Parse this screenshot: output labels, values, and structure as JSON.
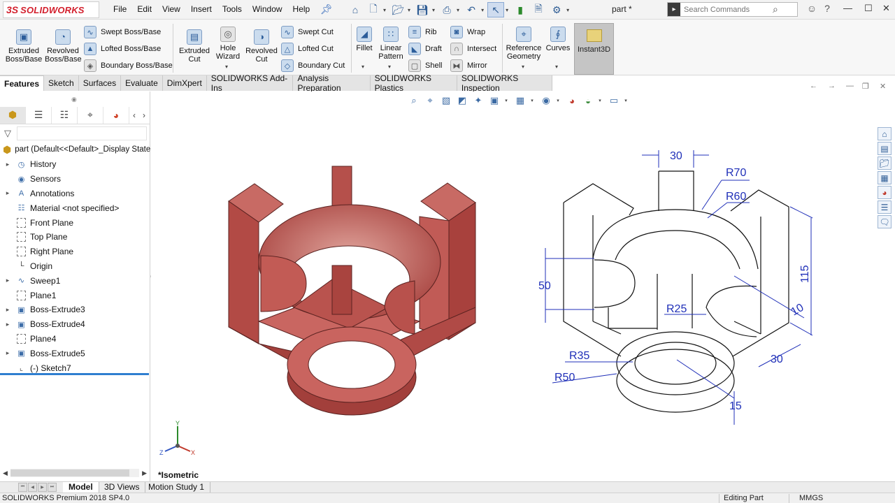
{
  "app": {
    "logo_mark": "3S",
    "logo_text": "SOLIDWORKS",
    "document_title": "part *"
  },
  "menu": [
    "File",
    "Edit",
    "View",
    "Insert",
    "Tools",
    "Window",
    "Help"
  ],
  "search": {
    "placeholder": "Search Commands"
  },
  "ribbon": {
    "extruded_boss": "Extruded Boss/Base",
    "revolved_boss": "Revolved Boss/Base",
    "swept_boss": "Swept Boss/Base",
    "lofted_boss": "Lofted Boss/Base",
    "boundary_boss": "Boundary Boss/Base",
    "extruded_cut": "Extruded Cut",
    "hole_wizard": "Hole Wizard",
    "revolved_cut": "Revolved Cut",
    "swept_cut": "Swept Cut",
    "lofted_cut": "Lofted Cut",
    "boundary_cut": "Boundary Cut",
    "fillet": "Fillet",
    "linear_pattern": "Linear Pattern",
    "rib": "Rib",
    "draft": "Draft",
    "shell": "Shell",
    "wrap": "Wrap",
    "intersect": "Intersect",
    "mirror": "Mirror",
    "reference_geometry": "Reference Geometry",
    "curves": "Curves",
    "instant3d": "Instant3D"
  },
  "command_tabs": [
    "Features",
    "Sketch",
    "Surfaces",
    "Evaluate",
    "DimXpert",
    "SOLIDWORKS Add-Ins",
    "Analysis Preparation",
    "SOLIDWORKS Plastics",
    "SOLIDWORKS Inspection"
  ],
  "feature_tree": {
    "root": "part  (Default<<Default>_Display State",
    "items": [
      {
        "label": "History",
        "icon": "history-icon",
        "expandable": true
      },
      {
        "label": "Sensors",
        "icon": "sensors-icon",
        "expandable": false
      },
      {
        "label": "Annotations",
        "icon": "annotations-icon",
        "expandable": true
      },
      {
        "label": "Material <not specified>",
        "icon": "material-icon",
        "expandable": false
      },
      {
        "label": "Front Plane",
        "icon": "plane-icon",
        "expandable": false
      },
      {
        "label": "Top Plane",
        "icon": "plane-icon",
        "expandable": false
      },
      {
        "label": "Right Plane",
        "icon": "plane-icon",
        "expandable": false
      },
      {
        "label": "Origin",
        "icon": "origin-icon",
        "expandable": false
      },
      {
        "label": "Sweep1",
        "icon": "sweep-icon",
        "expandable": true
      },
      {
        "label": "Plane1",
        "icon": "plane-icon",
        "expandable": false
      },
      {
        "label": "Boss-Extrude3",
        "icon": "extrude-icon",
        "expandable": true
      },
      {
        "label": "Boss-Extrude4",
        "icon": "extrude-icon",
        "expandable": true
      },
      {
        "label": "Plane4",
        "icon": "plane-icon",
        "expandable": false
      },
      {
        "label": "Boss-Extrude5",
        "icon": "extrude-icon",
        "expandable": true
      },
      {
        "label": "(-) Sketch7",
        "icon": "sketch-icon",
        "expandable": false
      }
    ]
  },
  "viewport": {
    "view_label": "*Isometric",
    "triad": {
      "y": "Y",
      "x": "X",
      "z": "Z"
    },
    "model_color": "#c0504d",
    "dimension_color": "#1f2fb8"
  },
  "drawing_dims": {
    "d30_top": "30",
    "r70": "R70",
    "r60": "R60",
    "d50": "50",
    "d115": "115",
    "d10": "10",
    "r25": "R25",
    "r35": "R35",
    "r50": "R50",
    "d30_side": "30",
    "d15": "15"
  },
  "bottom_tabs": [
    "Model",
    "3D Views",
    "Motion Study 1"
  ],
  "status": {
    "product": "SOLIDWORKS Premium 2018 SP4.0",
    "mode": "Editing Part",
    "units": "MMGS"
  }
}
